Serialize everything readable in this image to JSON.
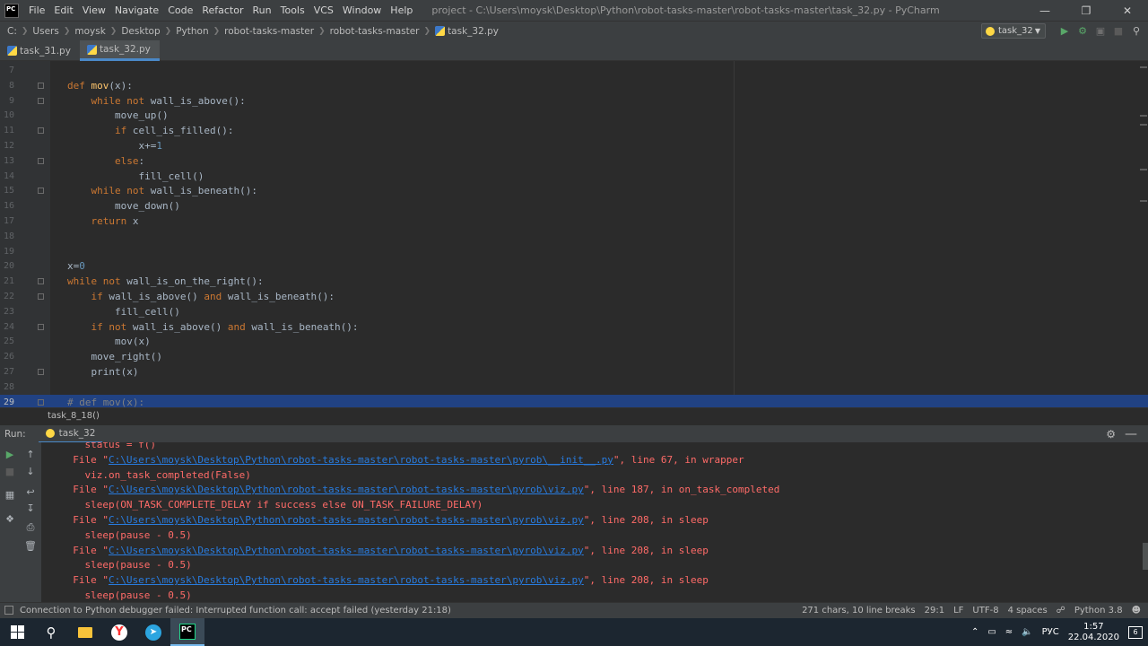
{
  "titlebar": {
    "app_icon_label": "PC",
    "menu": [
      "File",
      "Edit",
      "View",
      "Navigate",
      "Code",
      "Refactor",
      "Run",
      "Tools",
      "VCS",
      "Window",
      "Help"
    ],
    "title": "project - C:\\Users\\moysk\\Desktop\\Python\\robot-tasks-master\\robot-tasks-master\\task_32.py - PyCharm"
  },
  "breadcrumb": [
    "C:",
    "Users",
    "moysk",
    "Desktop",
    "Python",
    "robot-tasks-master",
    "robot-tasks-master",
    "task_32.py"
  ],
  "run_config": "task_32",
  "tabs": [
    {
      "label": "task_31.py",
      "active": false
    },
    {
      "label": "task_32.py",
      "active": true
    }
  ],
  "editor": {
    "lines": [
      {
        "n": "7",
        "code": ""
      },
      {
        "n": "8",
        "code": "def mov(x):"
      },
      {
        "n": "9",
        "code": "    while not wall_is_above():"
      },
      {
        "n": "10",
        "code": "        move_up()"
      },
      {
        "n": "11",
        "code": "        if cell_is_filled():"
      },
      {
        "n": "12",
        "code": "            x+=1"
      },
      {
        "n": "13",
        "code": "        else:"
      },
      {
        "n": "14",
        "code": "            fill_cell()"
      },
      {
        "n": "15",
        "code": "    while not wall_is_beneath():"
      },
      {
        "n": "16",
        "code": "        move_down()"
      },
      {
        "n": "17",
        "code": "    return x"
      },
      {
        "n": "18",
        "code": ""
      },
      {
        "n": "19",
        "code": ""
      },
      {
        "n": "20",
        "code": "x=0"
      },
      {
        "n": "21",
        "code": "while not wall_is_on_the_right():"
      },
      {
        "n": "22",
        "code": "    if wall_is_above() and wall_is_beneath():"
      },
      {
        "n": "23",
        "code": "        fill_cell()"
      },
      {
        "n": "24",
        "code": "    if not wall_is_above() and wall_is_beneath():"
      },
      {
        "n": "25",
        "code": "        mov(x)"
      },
      {
        "n": "26",
        "code": "    move_right()"
      },
      {
        "n": "27",
        "code": "    print(x)"
      },
      {
        "n": "28",
        "code": ""
      },
      {
        "n": "29",
        "code": "# def mov(x):"
      }
    ],
    "scope_indicator": "task_8_18()"
  },
  "run_panel": {
    "label": "Run:",
    "tab": "task_32",
    "console": [
      {
        "text": "    status = f()",
        "link": ""
      },
      {
        "pre": "  File \"",
        "link": "C:\\Users\\moysk\\Desktop\\Python\\robot-tasks-master\\robot-tasks-master\\pyrob\\__init__.py",
        "post": "\", line 67, in wrapper"
      },
      {
        "text": "    viz.on_task_completed(False)",
        "link": ""
      },
      {
        "pre": "  File \"",
        "link": "C:\\Users\\moysk\\Desktop\\Python\\robot-tasks-master\\robot-tasks-master\\pyrob\\viz.py",
        "post": "\", line 187, in on_task_completed"
      },
      {
        "text": "    sleep(ON_TASK_COMPLETE_DELAY if success else ON_TASK_FAILURE_DELAY)",
        "link": ""
      },
      {
        "pre": "  File \"",
        "link": "C:\\Users\\moysk\\Desktop\\Python\\robot-tasks-master\\robot-tasks-master\\pyrob\\viz.py",
        "post": "\", line 208, in sleep"
      },
      {
        "text": "    sleep(pause - 0.5)",
        "link": ""
      },
      {
        "pre": "  File \"",
        "link": "C:\\Users\\moysk\\Desktop\\Python\\robot-tasks-master\\robot-tasks-master\\pyrob\\viz.py",
        "post": "\", line 208, in sleep"
      },
      {
        "text": "    sleep(pause - 0.5)",
        "link": ""
      },
      {
        "pre": "  File \"",
        "link": "C:\\Users\\moysk\\Desktop\\Python\\robot-tasks-master\\robot-tasks-master\\pyrob\\viz.py",
        "post": "\", line 208, in sleep"
      },
      {
        "text": "    sleep(pause - 0.5)",
        "link": ""
      }
    ]
  },
  "statusbar": {
    "message": "Connection to Python debugger failed: Interrupted function call: accept failed (yesterday 21:18)",
    "chars": "271 chars, 10 line breaks",
    "position": "29:1",
    "line_sep": "LF",
    "encoding": "UTF-8",
    "indent": "4 spaces",
    "interpreter": "Python 3.8"
  },
  "taskbar": {
    "lang": "РУС",
    "time": "1:57",
    "date": "22.04.2020",
    "notif_count": "6"
  }
}
